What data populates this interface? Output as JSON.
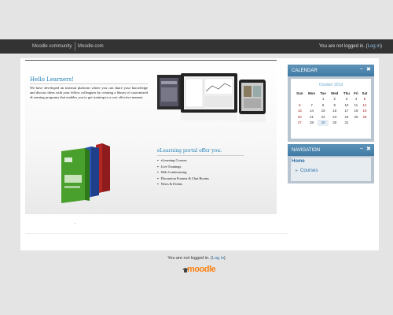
{
  "header": {
    "nav_items": [
      "Moodle community",
      "Moodle.com"
    ],
    "login_prefix": "You are not logged in. (",
    "login_link": "Log in",
    "login_suffix": ")"
  },
  "banner": {
    "hello_title": "Hello Learners!",
    "intro_text": "We have developed an internal platform where you can share your knowledge and discuss ideas with your fellow colleagues by creating a library of customized eLearning programs that enables you to get training in a cost effective manner.",
    "offer_title": "eLearning portal offer you:",
    "offer_items": [
      "eLearning Courses",
      "Live Trainings",
      "Web Conferencing",
      "Discussion Forums & Chat Rooms",
      "News & Events"
    ]
  },
  "calendar": {
    "title": "CALENDAR",
    "month": "October 2013",
    "weekdays": [
      "Sun",
      "Mon",
      "Tue",
      "Wed",
      "Thu",
      "Fri",
      "Sat"
    ],
    "weeks": [
      [
        "",
        "",
        "1",
        "2",
        "3",
        "4",
        "5"
      ],
      [
        "6",
        "7",
        "8",
        "9",
        "10",
        "11",
        "12"
      ],
      [
        "13",
        "14",
        "15",
        "16",
        "17",
        "18",
        "19"
      ],
      [
        "20",
        "21",
        "22",
        "23",
        "24",
        "25",
        "26"
      ],
      [
        "27",
        "28",
        "29",
        "30",
        "31",
        "",
        ""
      ]
    ],
    "today": "29"
  },
  "navigation": {
    "title": "NAVIGATION",
    "home": "Home",
    "courses": "Courses"
  },
  "footer": {
    "login_prefix": "You are not logged in. (",
    "login_link": "Log in",
    "login_suffix": ")",
    "logo_text": "moodle"
  },
  "colors": {
    "topbar": "#333333",
    "accent": "#1f7fb5",
    "block_header": "#4a84ad",
    "logo_orange": "#f98012"
  },
  "icons": [
    "minimize-icon",
    "close-icon",
    "expand-arrow-icon",
    "graduation-cap-icon"
  ]
}
